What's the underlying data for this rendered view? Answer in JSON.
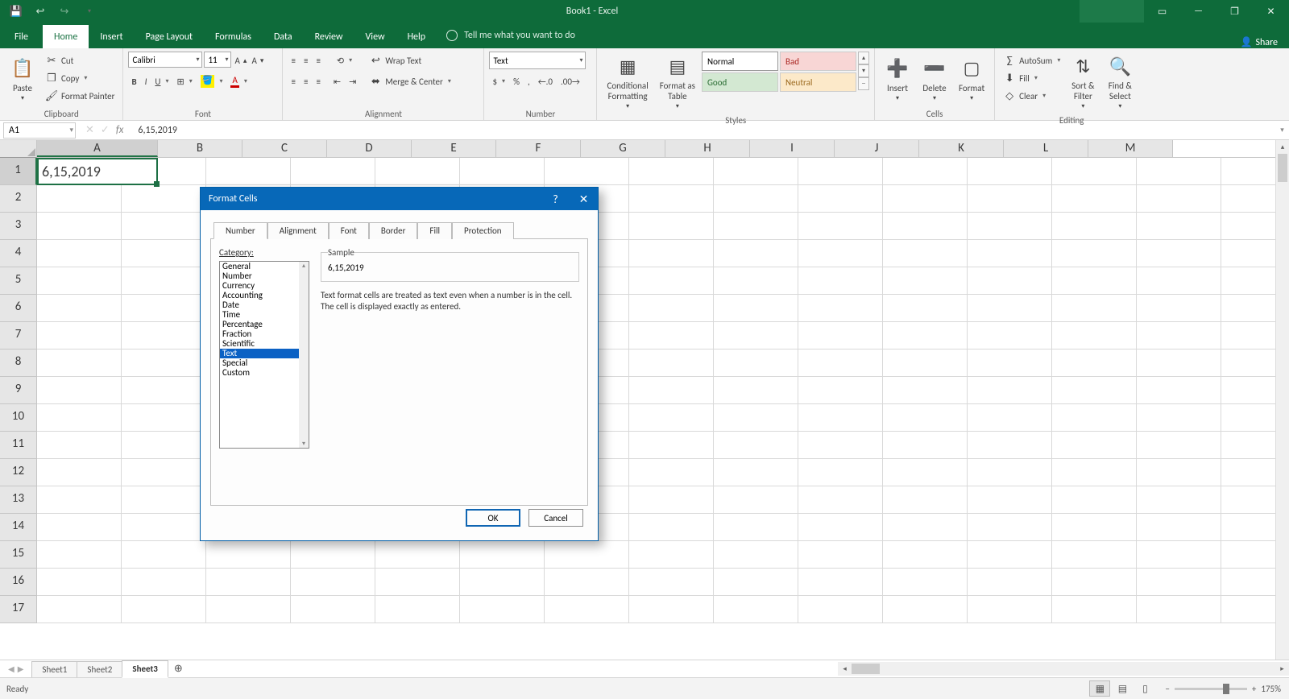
{
  "title": "Book1 - Excel",
  "share": "Share",
  "tabs": {
    "file": "File",
    "home": "Home",
    "insert": "Insert",
    "pageLayout": "Page Layout",
    "formulas": "Formulas",
    "data": "Data",
    "review": "Review",
    "view": "View",
    "help": "Help",
    "tell": "Tell me what you want to do"
  },
  "ribbon": {
    "clipboard": {
      "label": "Clipboard",
      "paste": "Paste",
      "cut": "Cut",
      "copy": "Copy",
      "fmtPainter": "Format Painter"
    },
    "font": {
      "label": "Font",
      "family": "Calibri",
      "size": "11"
    },
    "alignment": {
      "label": "Alignment",
      "wrap": "Wrap Text",
      "merge": "Merge & Center"
    },
    "number": {
      "label": "Number",
      "format": "Text"
    },
    "styles": {
      "label": "Styles",
      "cond": "Conditional\nFormatting",
      "fat": "Format as\nTable",
      "a": "Normal",
      "b": "Bad",
      "c": "Good",
      "d": "Neutral"
    },
    "cells": {
      "label": "Cells",
      "insert": "Insert",
      "delete": "Delete",
      "format": "Format"
    },
    "editing": {
      "label": "Editing",
      "sum": "AutoSum",
      "fill": "Fill",
      "clear": "Clear",
      "sort": "Sort &\nFilter",
      "find": "Find &\nSelect"
    }
  },
  "namebox": "A1",
  "formula": "6,15,2019",
  "cols": [
    "A",
    "B",
    "C",
    "D",
    "E",
    "F",
    "G",
    "H",
    "I",
    "J",
    "K",
    "L",
    "M"
  ],
  "rows": [
    "1",
    "2",
    "3",
    "4",
    "5",
    "6",
    "7",
    "8",
    "9",
    "10",
    "11",
    "12",
    "13",
    "14",
    "15",
    "16",
    "17"
  ],
  "cellValue": "6,15,2019",
  "sheets": {
    "s1": "Sheet1",
    "s2": "Sheet2",
    "s3": "Sheet3"
  },
  "status": {
    "ready": "Ready",
    "zoom": "175%"
  },
  "dialog": {
    "title": "Format Cells",
    "tabs": {
      "number": "Number",
      "alignment": "Alignment",
      "font": "Font",
      "border": "Border",
      "fill": "Fill",
      "protection": "Protection"
    },
    "catLabel": "Category:",
    "categories": [
      "General",
      "Number",
      "Currency",
      "Accounting",
      "Date",
      "Time",
      "Percentage",
      "Fraction",
      "Scientific",
      "Text",
      "Special",
      "Custom"
    ],
    "sampleLabel": "Sample",
    "sampleValue": "6,15,2019",
    "desc": "Text format cells are treated as text even when a number is in the cell. The cell is displayed exactly as entered.",
    "ok": "OK",
    "cancel": "Cancel"
  }
}
